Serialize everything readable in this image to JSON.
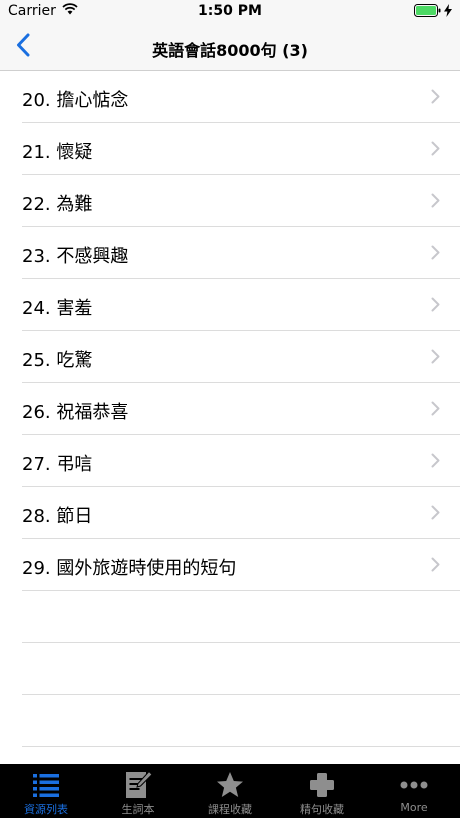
{
  "status_bar": {
    "carrier": "Carrier",
    "time": "1:50 PM"
  },
  "nav": {
    "title": "英語會話8000句 (3)",
    "back_icon": "chevron-left-icon"
  },
  "colors": {
    "accent": "#1a6fe0",
    "tab_inactive": "#8e8e8e",
    "battery": "#4cd964",
    "chevron": "#c7c7cc"
  },
  "list": {
    "items": [
      {
        "label": "20. 擔心惦念"
      },
      {
        "label": "21. 懷疑"
      },
      {
        "label": "22. 為難"
      },
      {
        "label": "23. 不感興趣"
      },
      {
        "label": "24. 害羞"
      },
      {
        "label": "25. 吃驚"
      },
      {
        "label": "26. 祝福恭喜"
      },
      {
        "label": "27. 弔唁"
      },
      {
        "label": "28. 節日"
      },
      {
        "label": "29. 國外旅遊時使用的短句"
      }
    ]
  },
  "tabs": [
    {
      "label": "資源列表",
      "icon": "list-icon",
      "active": true
    },
    {
      "label": "生詞本",
      "icon": "notebook-icon",
      "active": false
    },
    {
      "label": "課程收藏",
      "icon": "star-icon",
      "active": false
    },
    {
      "label": "精句收藏",
      "icon": "plus-icon",
      "active": false
    },
    {
      "label": "More",
      "icon": "more-icon",
      "active": false
    }
  ]
}
